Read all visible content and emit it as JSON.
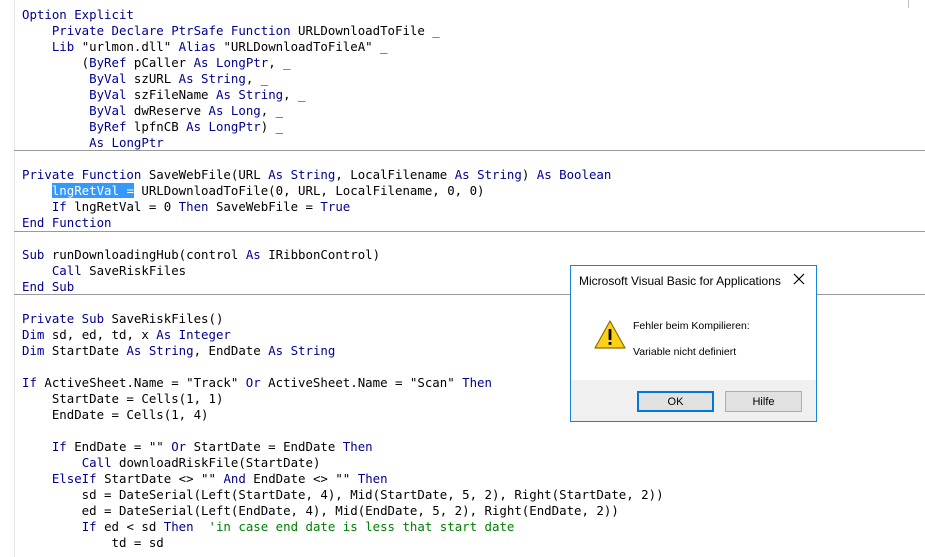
{
  "editor": {
    "lines": [
      [
        {
          "t": "Option Explicit",
          "k": 1
        }
      ],
      [
        {
          "t": "    "
        },
        {
          "t": "Private Declare PtrSafe Function",
          "k": 1
        },
        {
          "t": " URLDownloadToFile _"
        }
      ],
      [
        {
          "t": "    "
        },
        {
          "t": "Lib",
          "k": 1
        },
        {
          "t": " \"urlmon.dll\" "
        },
        {
          "t": "Alias",
          "k": 1
        },
        {
          "t": " \"URLDownloadToFileA\" _"
        }
      ],
      [
        {
          "t": "        ("
        },
        {
          "t": "ByRef",
          "k": 1
        },
        {
          "t": " pCaller "
        },
        {
          "t": "As",
          "k": 1
        },
        {
          "t": " "
        },
        {
          "t": "LongPtr",
          "k": 1
        },
        {
          "t": ", _"
        }
      ],
      [
        {
          "t": "         "
        },
        {
          "t": "ByVal",
          "k": 1
        },
        {
          "t": " szURL "
        },
        {
          "t": "As String",
          "k": 1
        },
        {
          "t": ", _"
        }
      ],
      [
        {
          "t": "         "
        },
        {
          "t": "ByVal",
          "k": 1
        },
        {
          "t": " szFileName "
        },
        {
          "t": "As String",
          "k": 1
        },
        {
          "t": ", _"
        }
      ],
      [
        {
          "t": "         "
        },
        {
          "t": "ByVal",
          "k": 1
        },
        {
          "t": " dwReserve "
        },
        {
          "t": "As Long",
          "k": 1
        },
        {
          "t": ", _"
        }
      ],
      [
        {
          "t": "         "
        },
        {
          "t": "ByRef",
          "k": 1
        },
        {
          "t": " lpfnCB "
        },
        {
          "t": "As",
          "k": 1
        },
        {
          "t": " "
        },
        {
          "t": "LongPtr",
          "k": 1
        },
        {
          "t": ") _"
        }
      ],
      [
        {
          "t": "         "
        },
        {
          "t": "As LongPtr",
          "k": 1
        }
      ],
      [],
      [
        {
          "t": "Private Function",
          "k": 1
        },
        {
          "t": " SaveWebFile(URL "
        },
        {
          "t": "As String",
          "k": 1
        },
        {
          "t": ", LocalFilename "
        },
        {
          "t": "As String",
          "k": 1
        },
        {
          "t": ") "
        },
        {
          "t": "As Boolean",
          "k": 1
        }
      ],
      [
        {
          "t": "    "
        },
        {
          "t": "lngRetVal =",
          "s": 1
        },
        {
          "t": " URLDownloadToFile(0, URL, LocalFilename, 0, 0)"
        }
      ],
      [
        {
          "t": "    "
        },
        {
          "t": "If",
          "k": 1
        },
        {
          "t": " lngRetVal = 0 "
        },
        {
          "t": "Then",
          "k": 1
        },
        {
          "t": " SaveWebFile = "
        },
        {
          "t": "True",
          "k": 1
        }
      ],
      [
        {
          "t": "End Function",
          "k": 1
        }
      ],
      [],
      [
        {
          "t": "Sub",
          "k": 1
        },
        {
          "t": " runDownloadingHub(control "
        },
        {
          "t": "As",
          "k": 1
        },
        {
          "t": " IRibbonControl)"
        }
      ],
      [
        {
          "t": "    "
        },
        {
          "t": "Call",
          "k": 1
        },
        {
          "t": " SaveRiskFiles"
        }
      ],
      [
        {
          "t": "End Sub",
          "k": 1
        }
      ],
      [],
      [
        {
          "t": "Private Sub",
          "k": 1
        },
        {
          "t": " SaveRiskFiles()"
        }
      ],
      [
        {
          "t": "Dim",
          "k": 1
        },
        {
          "t": " sd, ed, td, x "
        },
        {
          "t": "As Integer",
          "k": 1
        }
      ],
      [
        {
          "t": "Dim",
          "k": 1
        },
        {
          "t": " StartDate "
        },
        {
          "t": "As String",
          "k": 1
        },
        {
          "t": ", EndDate "
        },
        {
          "t": "As String",
          "k": 1
        }
      ],
      [],
      [
        {
          "t": "If",
          "k": 1
        },
        {
          "t": " ActiveSheet.Name = \"Track\" "
        },
        {
          "t": "Or",
          "k": 1
        },
        {
          "t": " ActiveSheet.Name = \"Scan\" "
        },
        {
          "t": "Then",
          "k": 1
        }
      ],
      [
        {
          "t": "    StartDate = Cells(1, 1)"
        }
      ],
      [
        {
          "t": "    EndDate = Cells(1, 4)"
        }
      ],
      [],
      [
        {
          "t": "    "
        },
        {
          "t": "If",
          "k": 1
        },
        {
          "t": " EndDate = \"\" "
        },
        {
          "t": "Or",
          "k": 1
        },
        {
          "t": " StartDate = EndDate "
        },
        {
          "t": "Then",
          "k": 1
        }
      ],
      [
        {
          "t": "        "
        },
        {
          "t": "Call",
          "k": 1
        },
        {
          "t": " downloadRiskFile(StartDate)"
        }
      ],
      [
        {
          "t": "    "
        },
        {
          "t": "ElseIf",
          "k": 1
        },
        {
          "t": " StartDate <> \"\" "
        },
        {
          "t": "And",
          "k": 1
        },
        {
          "t": " EndDate <> \"\" "
        },
        {
          "t": "Then",
          "k": 1
        }
      ],
      [
        {
          "t": "        sd = DateSerial(Left(StartDate, 4), Mid(StartDate, 5, 2), Right(StartDate, 2))"
        }
      ],
      [
        {
          "t": "        ed = DateSerial(Left(EndDate, 4), Mid(EndDate, 5, 2), Right(EndDate, 2))"
        }
      ],
      [
        {
          "t": "        "
        },
        {
          "t": "If",
          "k": 1
        },
        {
          "t": " ed < sd "
        },
        {
          "t": "Then",
          "k": 1
        },
        {
          "t": "  "
        },
        {
          "t": "'in case end date is less that start date",
          "c": 1
        }
      ],
      [
        {
          "t": "            td = sd"
        }
      ]
    ],
    "colors": {
      "keyword": "#00008b",
      "comment": "#008000",
      "selection": "#3399ff"
    }
  },
  "msgbox": {
    "title": "Microsoft Visual Basic for Applications",
    "close_icon": "close-icon",
    "warning_icon": "warning-icon",
    "message_line1": "Fehler beim Kompilieren:",
    "message_line2": "Variable nicht definiert",
    "ok_label": "OK",
    "help_label": "Hilfe"
  }
}
